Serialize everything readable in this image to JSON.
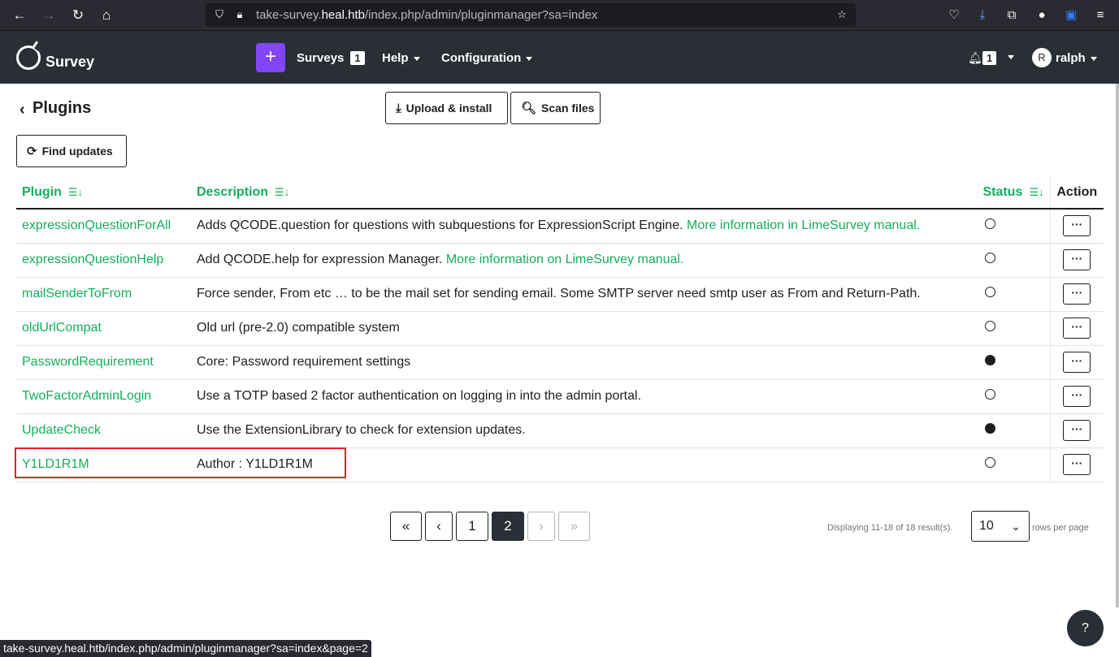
{
  "browser": {
    "url_prefix": "take-survey.",
    "url_host": "heal.htb",
    "url_path": "/index.php/admin/pluginmanager?sa=index",
    "status_url": "take-survey.heal.htb/index.php/admin/pluginmanager?sa=index&page=2"
  },
  "header": {
    "brand": "Survey",
    "add_label": "+",
    "surveys_label": "Surveys",
    "surveys_count": "1",
    "help_label": "Help",
    "configuration_label": "Configuration",
    "notifications_count": "1",
    "avatar_initial": "R",
    "username": "ralph"
  },
  "page": {
    "title": "Plugins",
    "upload_label": "Upload & install",
    "scan_label": "Scan files",
    "find_updates_label": "Find updates"
  },
  "table": {
    "columns": {
      "plugin": "Plugin",
      "description": "Description",
      "status": "Status",
      "action": "Action"
    },
    "rows": [
      {
        "name": "expressionQuestionForAll",
        "description": "Adds QCODE.question for questions with subquestions for ExpressionScript Engine. ",
        "link": "More information in LimeSurvey manual.",
        "active": false
      },
      {
        "name": "expressionQuestionHelp",
        "description": "Add QCODE.help for expression Manager. ",
        "link": "More information on LimeSurvey manual.",
        "active": false
      },
      {
        "name": "mailSenderToFrom",
        "description": "Force sender, From etc … to be the mail set for sending email. Some SMTP server need smtp user as From and Return-Path.",
        "link": "",
        "active": false
      },
      {
        "name": "oldUrlCompat",
        "description": "Old url (pre-2.0) compatible system",
        "link": "",
        "active": false
      },
      {
        "name": "PasswordRequirement",
        "description": "Core: Password requirement settings",
        "link": "",
        "active": true
      },
      {
        "name": "TwoFactorAdminLogin",
        "description": "Use a TOTP based 2 factor authentication on logging in into the admin portal.",
        "link": "",
        "active": false
      },
      {
        "name": "UpdateCheck",
        "description": "Use the ExtensionLibrary to check for extension updates.",
        "link": "",
        "active": true
      },
      {
        "name": "Y1LD1R1M",
        "description": "Author : Y1LD1R1M",
        "link": "",
        "active": false
      }
    ]
  },
  "pagination": {
    "first": "«",
    "prev": "‹",
    "page1": "1",
    "page2": "2",
    "next": "›",
    "last": "»",
    "displaying": "Displaying 11-18 of 18 result(s).",
    "rows_value": "10",
    "rows_label": "rows per page"
  }
}
